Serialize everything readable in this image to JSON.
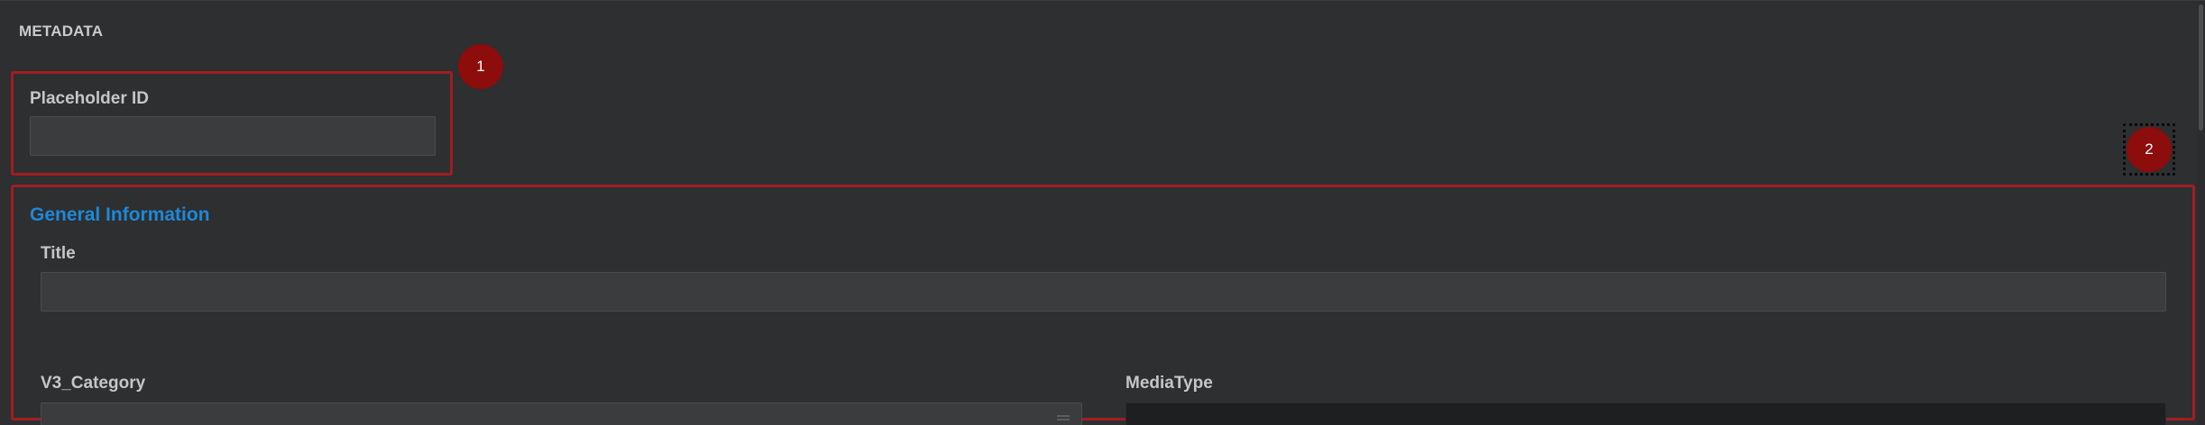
{
  "section": {
    "header": "METADATA"
  },
  "placeholder_id": {
    "label": "Placeholder ID",
    "value": "",
    "placeholder": ""
  },
  "general_information": {
    "title": "General Information",
    "title_field": {
      "label": "Title",
      "value": "",
      "placeholder": ""
    },
    "v3_category": {
      "label": "V3_Category",
      "value": ""
    },
    "media_type": {
      "label": "MediaType",
      "value": ""
    }
  },
  "annotations": {
    "marker_1": "1",
    "marker_2": "2",
    "color": "#8d0c0c",
    "box_color": "#a21d21"
  },
  "colors": {
    "background": "#2d2f31",
    "accent": "#1e88d8",
    "input_background": "#3a3c3d"
  }
}
